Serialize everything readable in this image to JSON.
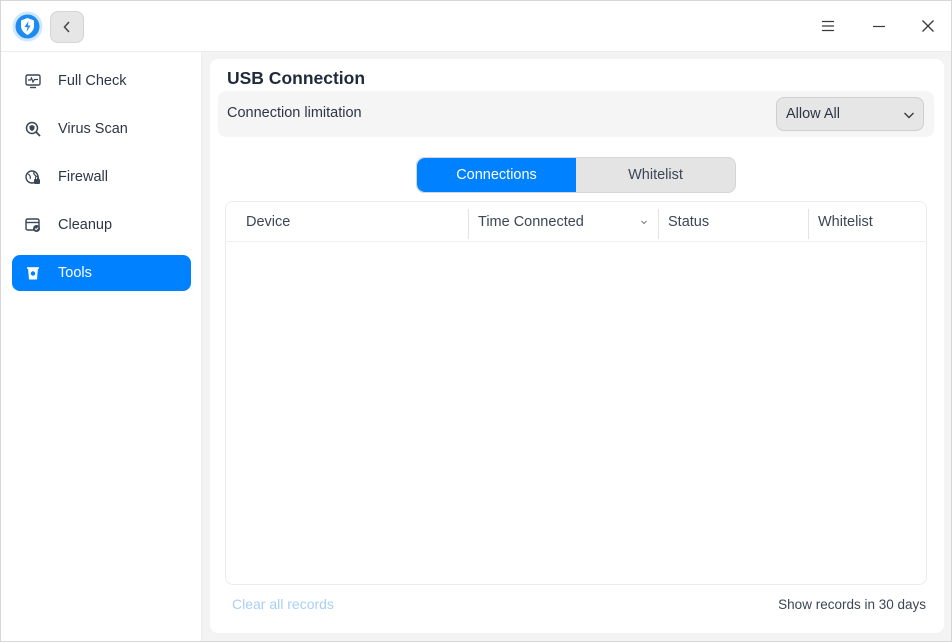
{
  "app": {
    "logo_icon": "shield-lightning-icon",
    "back_icon": "chevron-left-icon",
    "window_controls": [
      "menu-icon",
      "minimize-icon",
      "close-icon"
    ]
  },
  "sidebar": {
    "items": [
      {
        "label": "Full Check",
        "icon": "monitor-pulse-icon",
        "active": false
      },
      {
        "label": "Virus Scan",
        "icon": "magnifier-shield-icon",
        "active": false
      },
      {
        "label": "Firewall",
        "icon": "globe-lock-icon",
        "active": false
      },
      {
        "label": "Cleanup",
        "icon": "browser-clean-icon",
        "active": false
      },
      {
        "label": "Tools",
        "icon": "toolbox-icon",
        "active": true
      }
    ]
  },
  "main": {
    "title": "USB Connection",
    "limitation": {
      "label": "Connection limitation",
      "value": "Allow All"
    },
    "tabs": [
      {
        "label": "Connections",
        "active": true
      },
      {
        "label": "Whitelist",
        "active": false
      }
    ],
    "table": {
      "columns": [
        "Device",
        "Time Connected",
        "Status",
        "Whitelist"
      ],
      "rows": []
    },
    "footer": {
      "clear_label": "Clear all records",
      "info": "Show records in 30 days"
    }
  },
  "colors": {
    "accent": "#0081ff",
    "disabled_link": "#a9cff5"
  }
}
